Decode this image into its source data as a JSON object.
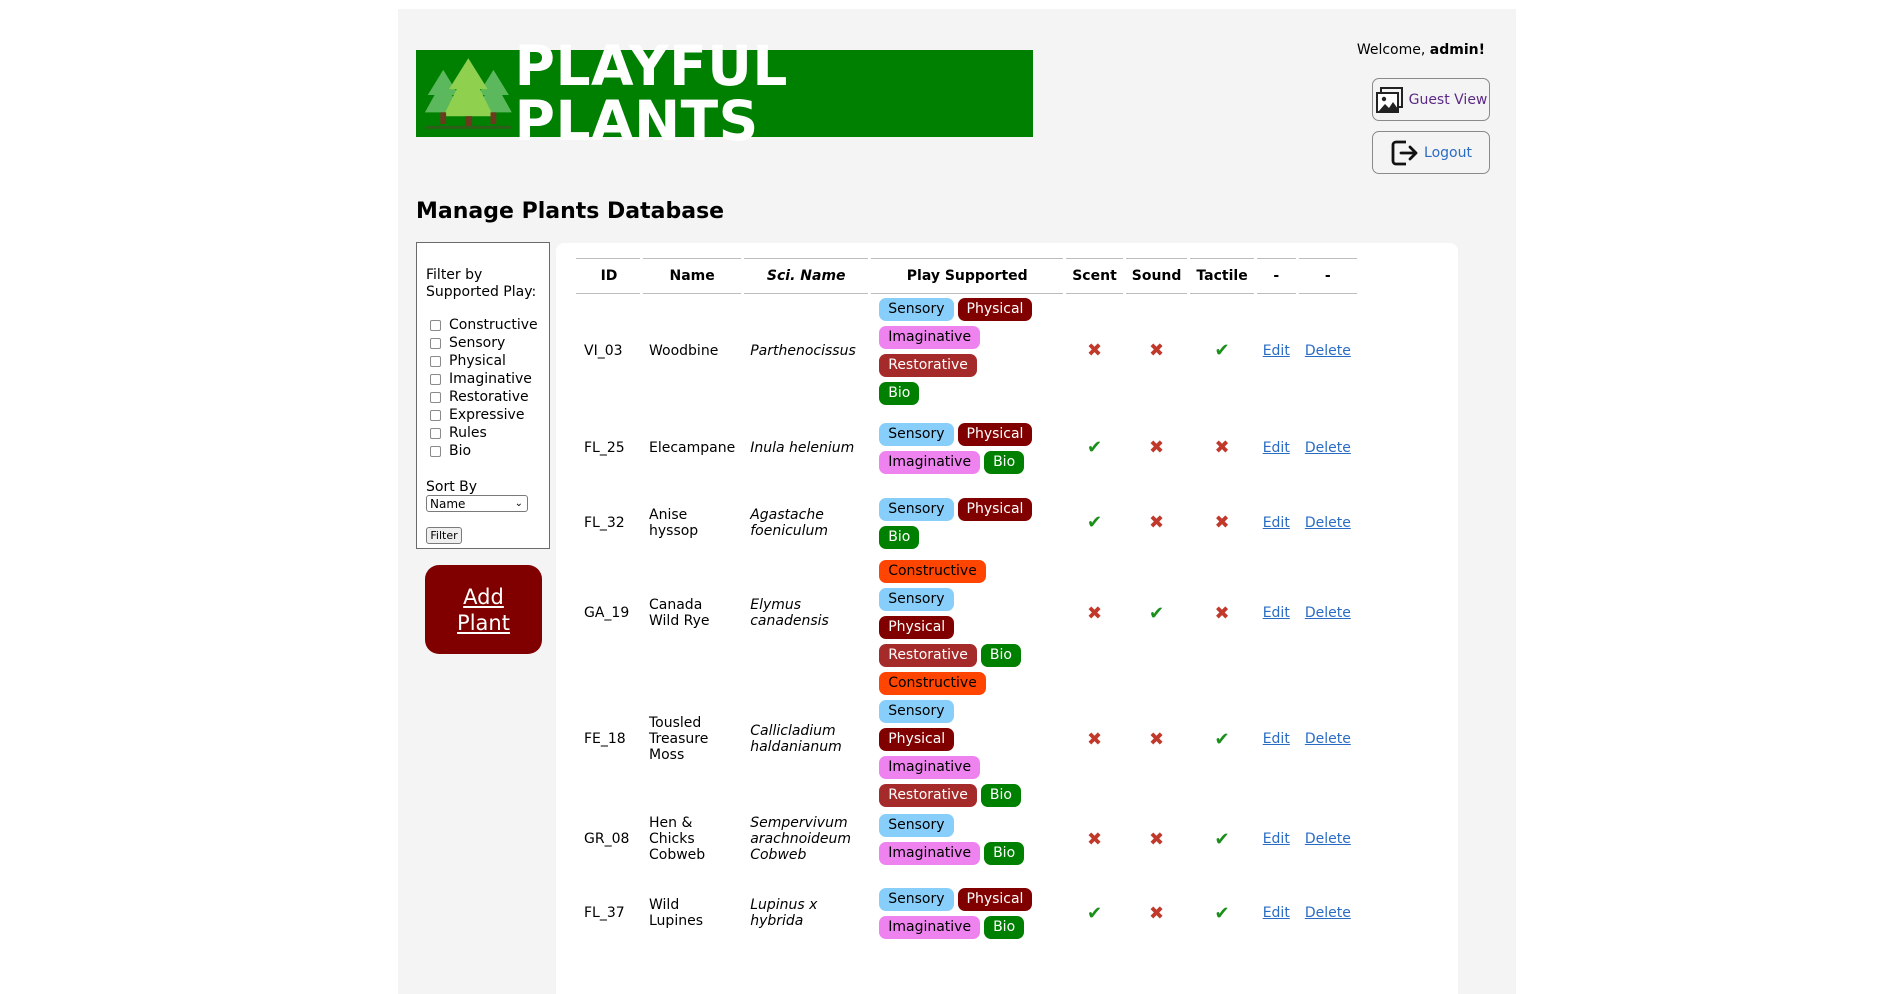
{
  "header": {
    "brand": "PLAYFUL PLANTS",
    "welcome_prefix": "Welcome, ",
    "username": "admin!",
    "guest_view_label": "Guest View",
    "logout_label": "Logout"
  },
  "page": {
    "title": "Manage Plants Database"
  },
  "filter": {
    "label": "Filter by Supported Play:",
    "options": [
      "Constructive",
      "Sensory",
      "Physical",
      "Imaginative",
      "Restorative",
      "Expressive",
      "Rules",
      "Bio"
    ],
    "sort_label": "Sort By",
    "sort_value": "Name",
    "filter_button": "Filter"
  },
  "add_plant": {
    "line1": "Add",
    "line2": "Plant"
  },
  "table": {
    "headers": [
      "ID",
      "Name",
      "Sci. Name",
      "Play Supported",
      "Scent",
      "Sound",
      "Tactile",
      "-",
      "-"
    ],
    "edit_label": "Edit",
    "delete_label": "Delete",
    "rows": [
      {
        "id": "VI_03",
        "name": "Woodbine",
        "sci": "Parthenocissus",
        "tags": [
          "Sensory",
          "Physical",
          "Imaginative",
          "Restorative",
          "Bio"
        ],
        "scent": false,
        "sound": false,
        "tactile": true
      },
      {
        "id": "FL_25",
        "name": "Elecampane",
        "sci": "Inula helenium",
        "tags": [
          "Sensory",
          "Physical",
          "Imaginative",
          "Bio"
        ],
        "scent": true,
        "sound": false,
        "tactile": false
      },
      {
        "id": "FL_32",
        "name": "Anise hyssop",
        "sci": "Agastache foeniculum",
        "tags": [
          "Sensory",
          "Physical",
          "Bio"
        ],
        "scent": true,
        "sound": false,
        "tactile": false
      },
      {
        "id": "GA_19",
        "name": "Canada Wild Rye",
        "sci": "Elymus canadensis",
        "tags": [
          "Constructive",
          "Sensory",
          "Physical",
          "Restorative",
          "Bio"
        ],
        "scent": false,
        "sound": true,
        "tactile": false
      },
      {
        "id": "FE_18",
        "name": "Tousled Treasure Moss",
        "sci": "Callicladium haldanianum",
        "tags": [
          "Constructive",
          "Sensory",
          "Physical",
          "Imaginative",
          "Restorative",
          "Bio"
        ],
        "scent": false,
        "sound": false,
        "tactile": true
      },
      {
        "id": "GR_08",
        "name": "Hen & Chicks Cobweb",
        "sci": "Sempervivum arachnoideum Cobweb",
        "tags": [
          "Sensory",
          "Imaginative",
          "Bio"
        ],
        "scent": false,
        "sound": false,
        "tactile": true
      },
      {
        "id": "FL_37",
        "name": "Wild Lupines",
        "sci": "Lupinus x hybrida",
        "tags": [
          "Sensory",
          "Physical",
          "Imaginative",
          "Bio"
        ],
        "scent": true,
        "sound": false,
        "tactile": true
      }
    ]
  },
  "colors": {
    "Sensory": "#87cefa",
    "Physical": "#800000",
    "Imaginative": "#ee82ee",
    "Restorative": "#a52a2a",
    "Bio": "#008000",
    "Constructive": "#ff4500"
  }
}
